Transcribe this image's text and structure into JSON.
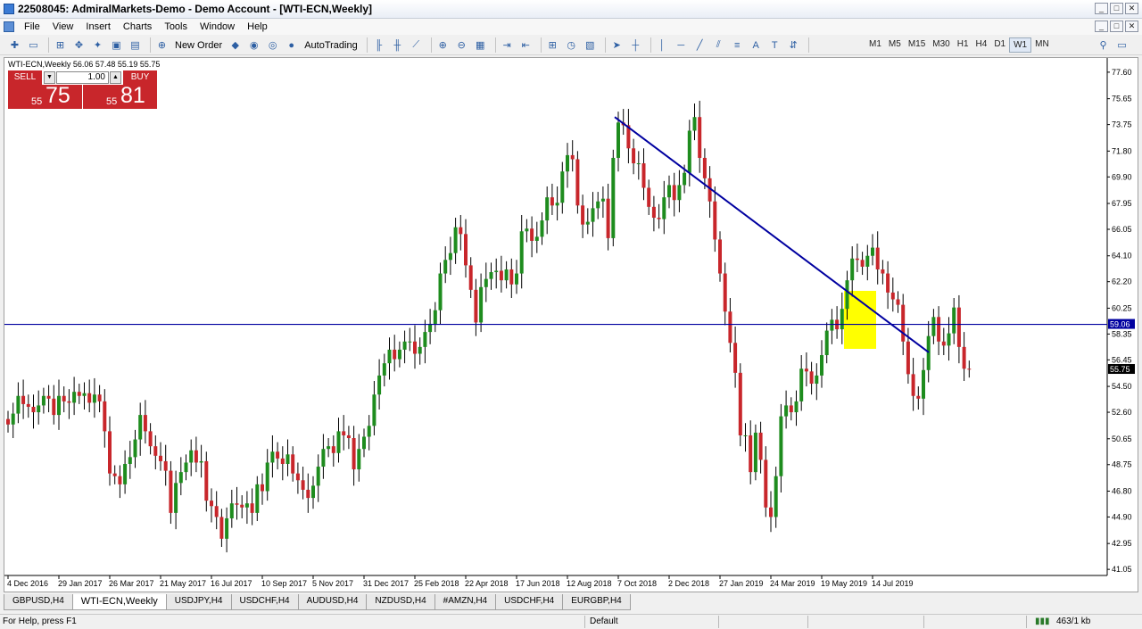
{
  "window": {
    "title": "22508045: AdmiralMarkets-Demo - Demo Account - [WTI-ECN,Weekly]",
    "buttons": [
      "_",
      "□",
      "✕"
    ],
    "inner_buttons": [
      "_",
      "□",
      "✕"
    ]
  },
  "menu": [
    "File",
    "View",
    "Insert",
    "Charts",
    "Tools",
    "Window",
    "Help"
  ],
  "toolbar": {
    "new_order": "New Order",
    "auto_trading": "AutoTrading",
    "timeframes": [
      "M1",
      "M5",
      "M15",
      "M30",
      "H1",
      "H4",
      "D1",
      "W1",
      "MN"
    ],
    "active_timeframe": "W1"
  },
  "chart": {
    "symbol_info": "WTI-ECN,Weekly  56.06 57.48 55.19 55.75",
    "horizontal_line_label": "59.06",
    "current_price_label": "55.75",
    "colors": {
      "bull": "#1e8c1e",
      "bear": "#c8262b",
      "line": "#0000a0",
      "highlight": "#ffff00"
    }
  },
  "trade_panel": {
    "sell_label": "SELL",
    "buy_label": "BUY",
    "lot": "1.00",
    "sell_small": "55",
    "sell_big": "75",
    "buy_small": "55",
    "buy_big": "81"
  },
  "chart_data": {
    "type": "candlestick",
    "y_ticks": [
      "77.60",
      "75.65",
      "73.75",
      "71.80",
      "69.90",
      "67.95",
      "66.05",
      "64.10",
      "62.20",
      "60.25",
      "58.35",
      "56.45",
      "54.50",
      "52.60",
      "50.65",
      "48.75",
      "46.80",
      "44.90",
      "42.95",
      "41.05"
    ],
    "x_labels": [
      "4 Dec 2016",
      "29 Jan 2017",
      "26 Mar 2017",
      "21 May 2017",
      "16 Jul 2017",
      "10 Sep 2017",
      "5 Nov 2017",
      "31 Dec 2017",
      "25 Feb 2018",
      "22 Apr 2018",
      "17 Jun 2018",
      "12 Aug 2018",
      "7 Oct 2018",
      "2 Dec 2018",
      "27 Jan 2019",
      "24 Mar 2019",
      "19 May 2019",
      "14 Jul 2019"
    ],
    "horizontal_line": 59.06,
    "trendline": {
      "start": [
        "7 Oct 2018",
        74.3
      ],
      "end": [
        "after 14 Jul 2019",
        57.0
      ]
    },
    "closes": [
      51.7,
      52.5,
      53.8,
      53.2,
      53.0,
      52.6,
      53.1,
      53.8,
      53.6,
      52.4,
      53.8,
      53.4,
      53.3,
      54.1,
      53.8,
      54.0,
      53.3,
      53.9,
      53.4,
      51.2,
      48.1,
      47.9,
      47.3,
      48.8,
      49.3,
      50.6,
      52.4,
      51.2,
      50.1,
      49.4,
      49.0,
      48.3,
      45.2,
      47.4,
      48.2,
      48.9,
      49.8,
      48.9,
      49.0,
      46.1,
      45.7,
      44.9,
      43.3,
      44.8,
      45.9,
      45.8,
      45.6,
      45.9,
      45.2,
      47.3,
      46.8,
      48.9,
      49.7,
      49.2,
      48.8,
      49.5,
      48.1,
      47.6,
      46.9,
      46.3,
      47.2,
      48.6,
      49.9,
      50.1,
      49.6,
      51.2,
      50.9,
      50.7,
      48.4,
      49.9,
      50.8,
      51.6,
      53.9,
      55.3,
      56.2,
      57.2,
      56.5,
      57.2,
      57.8,
      57.8,
      56.9,
      57.4,
      58.5,
      59.1,
      60.1,
      62.8,
      63.8,
      64.3,
      66.2,
      65.7,
      63.4,
      61.6,
      59.2,
      61.8,
      62.4,
      62.9,
      63.0,
      62.3,
      63.1,
      62.0,
      62.8,
      65.9,
      66.1,
      65.2,
      65.5,
      66.7,
      68.4,
      67.8,
      68.0,
      70.3,
      71.5,
      71.2,
      67.8,
      66.4,
      66.6,
      67.6,
      68.1,
      68.3,
      65.4,
      71.3,
      73.9,
      73.7,
      72.0,
      70.9,
      70.9,
      69.1,
      67.7,
      66.9,
      66.8,
      68.4,
      69.3,
      68.2,
      69.3,
      70.2,
      73.3,
      74.3,
      71.3,
      69.8,
      68.1,
      65.3,
      62.8,
      60.0,
      57.7,
      55.5,
      50.9,
      50.9,
      48.2,
      51.1,
      49.1,
      45.6,
      44.9,
      47.9,
      52.3,
      53.1,
      52.6,
      53.4,
      55.8,
      55.6,
      54.7,
      55.3,
      56.8,
      58.6,
      59.4,
      58.7,
      60.2,
      62.3,
      63.9,
      63.8,
      63.3,
      64.1,
      64.7,
      63.1,
      62.8,
      61.4,
      60.9,
      60.5,
      57.8,
      55.4,
      53.8,
      53.6,
      55.7,
      58.2,
      59.6,
      57.8,
      57.5,
      58.4,
      60.3,
      57.4,
      55.8,
      55.75
    ]
  },
  "tabs": [
    "GBPUSD,H4",
    "WTI-ECN,Weekly",
    "USDJPY,H4",
    "USDCHF,H4",
    "AUDUSD,H4",
    "NZDUSD,H4",
    "#AMZN,H4",
    "USDCHF,H4",
    "EURGBP,H4"
  ],
  "active_tab": "WTI-ECN,Weekly",
  "status": {
    "help": "For Help, press F1",
    "profile": "Default",
    "traffic": "463/1 kb"
  }
}
